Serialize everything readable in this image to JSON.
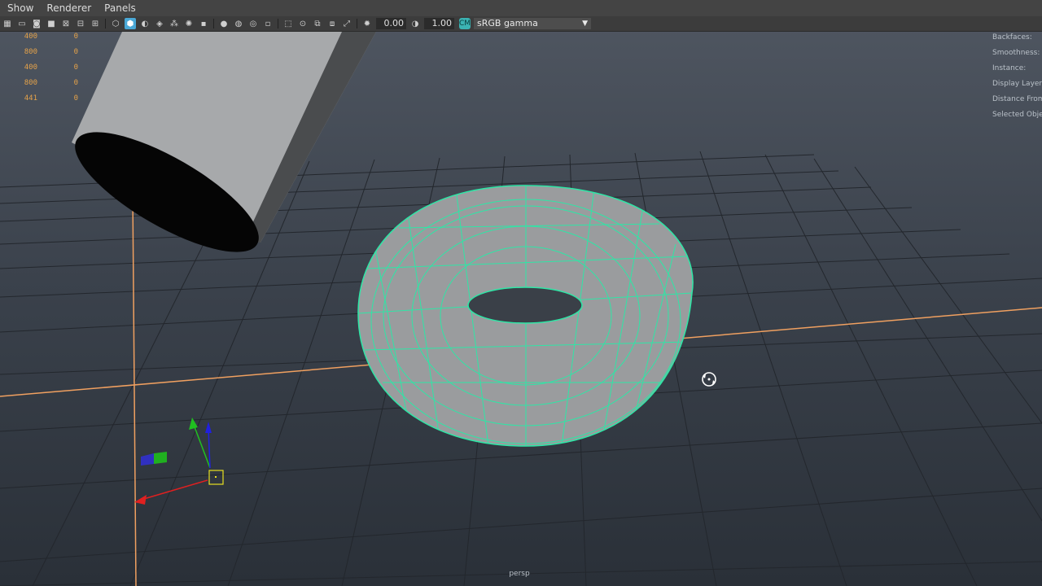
{
  "menu": {
    "items": [
      "Show",
      "Renderer",
      "Panels"
    ]
  },
  "toolbar": {
    "exposure": "0.00",
    "gamma": "1.00",
    "color_space_icon": "colorspace-icon",
    "color_space": "sRGB gamma",
    "icons": [
      "grid-icon",
      "film-gate-icon",
      "resolution-gate-icon",
      "gate-mask-icon",
      "field-chart-icon",
      "safe-action-icon",
      "wireframe-icon",
      "smooth-shade-icon",
      "default-material-icon",
      "textured-icon",
      "lights-icon",
      "shadows-icon",
      "screen-space-ao-icon",
      "motion-blur-icon",
      "anti-alias-icon",
      "depth-of-field-icon",
      "xray-icon",
      "xray-joints-icon",
      "isolate-select-icon",
      "camera-attributes-icon",
      "bookmarks-icon",
      "image-plane-icon",
      "exposure-icon",
      "gamma-icon"
    ]
  },
  "hud_left": [
    {
      "a": "400",
      "b": "0"
    },
    {
      "a": "800",
      "b": "0"
    },
    {
      "a": "400",
      "b": "0"
    },
    {
      "a": "800",
      "b": "0"
    },
    {
      "a": "441",
      "b": "0"
    }
  ],
  "hud_right": [
    "Backfaces:",
    "Smoothness:",
    "Instance:",
    "Display Layer:",
    "Distance From",
    "Selected Objec"
  ],
  "viewport": {
    "camera": "persp"
  },
  "colors": {
    "wireframe_selected": "#2ee6a6",
    "grid_axis": "#f0a060",
    "gizmo_x": "#e02020",
    "gizmo_y": "#20c020",
    "gizmo_z": "#2020e0",
    "pivot_box": "#e8e020"
  }
}
